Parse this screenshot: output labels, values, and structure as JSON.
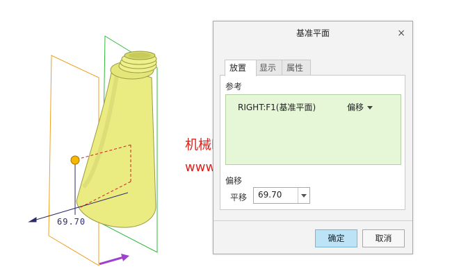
{
  "watermark": {
    "site_name": "机械时代网",
    "site_url": "www.jxage.com"
  },
  "viewport": {
    "dimension_label": "69.70"
  },
  "dialog": {
    "title": "基准平面",
    "close_glyph": "×",
    "tabs": [
      {
        "label": "放置",
        "active": true
      },
      {
        "label": "显示",
        "active": false
      },
      {
        "label": "属性",
        "active": false
      }
    ],
    "references": {
      "section_label": "参考",
      "items": [
        {
          "name": "RIGHT:F1(基准平面)",
          "constraint": "偏移"
        }
      ]
    },
    "offset": {
      "section_label": "偏移",
      "field_label": "平移",
      "value": "69.70"
    },
    "buttons": {
      "ok": "确定",
      "cancel": "取消"
    }
  },
  "colors": {
    "model_fill": "#eaec82",
    "plane_orange": "#f0a020",
    "plane_green": "#2dbb3a",
    "drag_handle": "#f5b800",
    "arrow_purple": "#a040d0",
    "dimension_line": "#2a2a6a",
    "reference_box": "#e6f7d8",
    "ok_button": "#bde3f7"
  }
}
